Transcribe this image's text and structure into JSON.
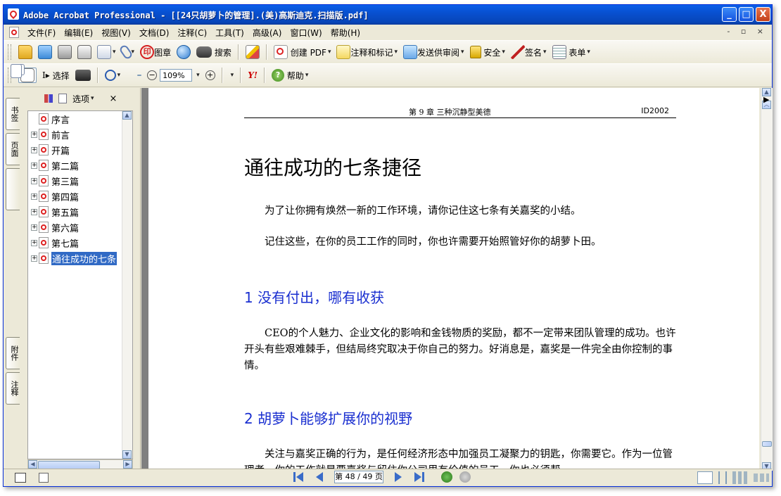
{
  "window": {
    "title": "Adobe Acrobat Professional - [[24只胡萝卜的管理].(美)高斯迪克.扫描版.pdf]",
    "controls": {
      "minimize": "_",
      "maximize": "□",
      "close": "X"
    }
  },
  "menubar": {
    "items": [
      "文件(F)",
      "编辑(E)",
      "视图(V)",
      "文档(D)",
      "注释(C)",
      "工具(T)",
      "高级(A)",
      "窗口(W)",
      "帮助(H)"
    ],
    "mdi_controls": "- ▫ ×"
  },
  "toolbar1": {
    "stamp_label": "图章",
    "search_label": "搜索",
    "create_pdf_label": "创建 PDF",
    "comment_markup_label": "注释和标记",
    "send_review_label": "发送供审阅",
    "security_label": "安全",
    "sign_label": "签名",
    "forms_label": "表单",
    "stamp_glyph": "印"
  },
  "toolbar2": {
    "select_label": "选择",
    "zoom_value": "109%",
    "yahoo_label": "Y!",
    "help_label": "帮助",
    "help_glyph": "?",
    "zoom_out_glyph": "−",
    "zoom_in_glyph": "+"
  },
  "sidetabs": {
    "bookmarks": "书签",
    "pages": "页面",
    "attachments": "附件",
    "comments": "注释"
  },
  "navpanel": {
    "options_label": "选项",
    "close_label": "×",
    "bookmarks": [
      {
        "label": "序言",
        "expandable": false,
        "selected": false
      },
      {
        "label": "前言",
        "expandable": true,
        "selected": false
      },
      {
        "label": "开篇",
        "expandable": true,
        "selected": false
      },
      {
        "label": "第二篇",
        "expandable": true,
        "selected": false
      },
      {
        "label": "第三篇",
        "expandable": true,
        "selected": false
      },
      {
        "label": "第四篇",
        "expandable": true,
        "selected": false
      },
      {
        "label": "第五篇",
        "expandable": true,
        "selected": false
      },
      {
        "label": "第六篇",
        "expandable": true,
        "selected": false
      },
      {
        "label": "第七篇",
        "expandable": true,
        "selected": false
      },
      {
        "label": "通往成功的七条",
        "expandable": true,
        "selected": true
      }
    ]
  },
  "document": {
    "running_head": "第 9 章  三种沉静型美德",
    "running_id": "ID2002",
    "title": "通往成功的七条捷径",
    "intro1": "为了让你拥有焕然一新的工作环境，请你记住这七条有关嘉奖的小结。",
    "intro2": "记住这些，在你的员工工作的同时，你也许需要开始照管好你的胡萝卜田。",
    "section1_heading": "1  没有付出，哪有收获",
    "section1_body": "CEO的个人魅力、企业文化的影响和金钱物质的奖励，都不一定带来团队管理的成功。也许开头有些艰难棘手，但结局终究取决于你自己的努力。好消息是，嘉奖是一件完全由你控制的事情。",
    "section2_heading": "2  胡萝卜能够扩展你的视野",
    "section2_body": "关注与嘉奖正确的行为，是任何经济形态中加强员工凝聚力的钥匙，你需要它。作为一位管理者，你的工作就是要嘉奖与留住你公司里有价值的员工。你也必须帮"
  },
  "statusbar": {
    "page_indicator": "第 48 / 49 页"
  }
}
